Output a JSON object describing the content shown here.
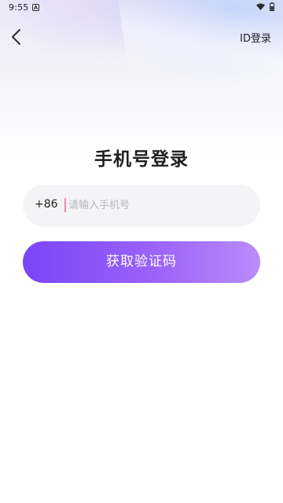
{
  "status_bar": {
    "time": "9:55",
    "icons": [
      "a-icon",
      "wifi-icon",
      "battery-icon"
    ]
  },
  "nav": {
    "back_icon": "chevron-left-icon",
    "id_login_label": "ID登录"
  },
  "title": "手机号登录",
  "phone_field": {
    "country_code": "+86",
    "value": "",
    "placeholder": "请输入手机号"
  },
  "get_code_button_label": "获取验证码",
  "colors": {
    "button_gradient_start": "#7a45f7",
    "button_gradient_end": "#b98cfa",
    "field_background": "#f4f4f6",
    "cursor": "#f08aa7",
    "text_primary": "#1f1f1f",
    "placeholder": "#b8b8be"
  }
}
